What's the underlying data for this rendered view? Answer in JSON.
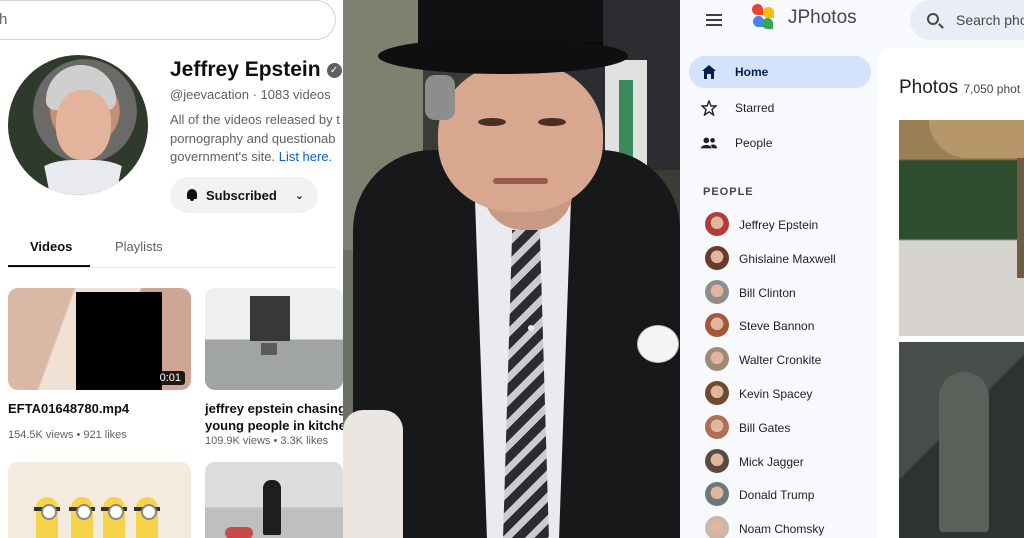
{
  "left_panel": {
    "search_partial": "h",
    "channel": {
      "name": "Jeffrey Epstein",
      "meta": "@jeevacation · 1083 videos",
      "desc_line1": "All of the videos released by t",
      "desc_line2": "pornography and questionab",
      "desc_line3": "government's site.",
      "desc_link": "List here.",
      "subscribed_label": "Subscribed"
    },
    "tabs": [
      {
        "label": "Videos",
        "active": true
      },
      {
        "label": "Playlists",
        "active": false
      }
    ],
    "videos": [
      {
        "title": "EFTA01648780.mp4",
        "stats": "154.5K views • 921 likes",
        "duration": "0:01"
      },
      {
        "title_line1": "jeffrey epstein chasing",
        "title_line2": "young people in kitche",
        "stats": "109.9K views • 3.3K likes"
      }
    ]
  },
  "right_panel": {
    "app_name": "JPhotos",
    "search_placeholder": "Search pho",
    "nav": [
      {
        "label": "Home",
        "icon": "home-icon",
        "active": true
      },
      {
        "label": "Starred",
        "icon": "star-icon",
        "active": false
      },
      {
        "label": "People",
        "icon": "people-icon",
        "active": false
      }
    ],
    "people_section_label": "PEOPLE",
    "people": [
      {
        "name": "Jeffrey Epstein",
        "color": "#b33a3a"
      },
      {
        "name": "Ghislaine Maxwell",
        "color": "#6b3b2a"
      },
      {
        "name": "Bill Clinton",
        "color": "#8e8e8e"
      },
      {
        "name": "Steve Bannon",
        "color": "#a5573b"
      },
      {
        "name": "Walter Cronkite",
        "color": "#9b8c7a"
      },
      {
        "name": "Kevin Spacey",
        "color": "#6e4b2e"
      },
      {
        "name": "Bill Gates",
        "color": "#b06e56"
      },
      {
        "name": "Mick Jagger",
        "color": "#5a4a44"
      },
      {
        "name": "Donald Trump",
        "color": "#6a7a7a"
      },
      {
        "name": "Noam Chomsky",
        "color": "#c7b8a8"
      }
    ],
    "content_title": "Photos",
    "content_count": "7,050 phot"
  },
  "colors": {
    "link_blue": "#065fd4",
    "nav_active_bg": "#d3e3fd",
    "photos_bg": "#f8f9fc"
  }
}
